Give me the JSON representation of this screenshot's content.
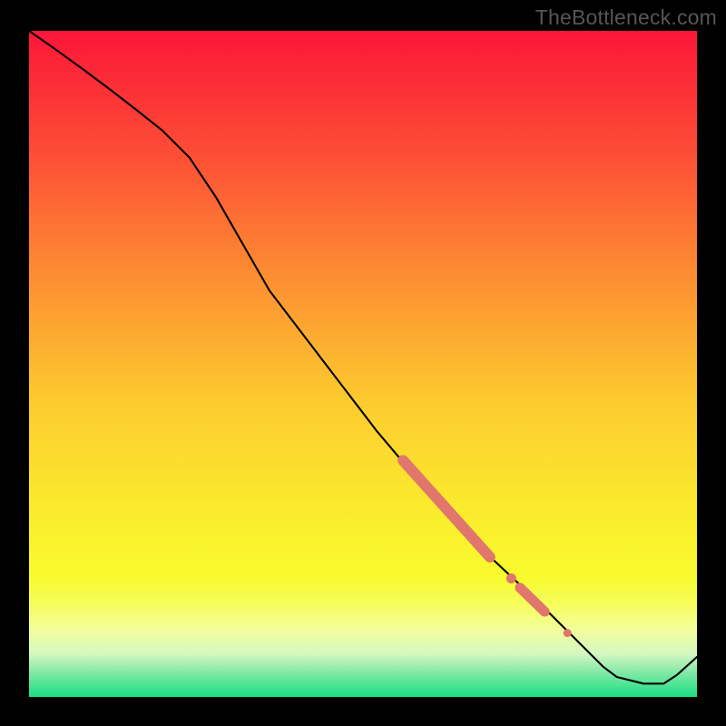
{
  "watermark": "TheBottleneck.com",
  "chart_data": {
    "type": "line",
    "title": "",
    "xlabel": "",
    "ylabel": "",
    "xlim": [
      0,
      100
    ],
    "ylim": [
      0,
      100
    ],
    "grid": false,
    "legend": false,
    "background": {
      "type": "vertical-gradient",
      "stops": [
        {
          "pos": 0.0,
          "color": "#fc1638"
        },
        {
          "pos": 0.18,
          "color": "#fd4c35"
        },
        {
          "pos": 0.36,
          "color": "#fd8b32"
        },
        {
          "pos": 0.55,
          "color": "#fcc92e"
        },
        {
          "pos": 0.7,
          "color": "#fbe82d"
        },
        {
          "pos": 0.82,
          "color": "#f8fb2d"
        },
        {
          "pos": 0.86,
          "color": "#f6fd5b"
        },
        {
          "pos": 0.9,
          "color": "#f2fe9d"
        },
        {
          "pos": 0.935,
          "color": "#d4f8c1"
        },
        {
          "pos": 0.965,
          "color": "#7de8a3"
        },
        {
          "pos": 1.0,
          "color": "#1adf82"
        }
      ]
    },
    "series": [
      {
        "name": "main-curve",
        "color": "#000000",
        "width": 2.1,
        "x": [
          0.0,
          4.0,
          8.0,
          12.0,
          16.0,
          20.0,
          24.0,
          28.0,
          32.0,
          36.0,
          44.0,
          52.0,
          60.0,
          68.0,
          76.0,
          82.0,
          86.0,
          88.0,
          92.0,
          95.0,
          97.0,
          100.0
        ],
        "y": [
          100.0,
          97.2,
          94.3,
          91.3,
          88.2,
          85.0,
          81.0,
          75.0,
          68.0,
          61.0,
          50.5,
          40.0,
          30.5,
          22.0,
          14.5,
          8.5,
          4.5,
          3.0,
          2.0,
          2.0,
          3.3,
          6.0
        ]
      }
    ],
    "markers": [
      {
        "name": "highlight-segment-1",
        "type": "capsule",
        "color": "#e1766c",
        "width": 12,
        "x1": 56.0,
        "y1": 35.5,
        "x2": 69.0,
        "y2": 21.0
      },
      {
        "name": "highlight-dot-1",
        "type": "circle",
        "color": "#e1766c",
        "r": 5.5,
        "x": 72.2,
        "y": 17.8
      },
      {
        "name": "highlight-segment-2",
        "type": "capsule",
        "color": "#e1766c",
        "width": 11,
        "x1": 73.5,
        "y1": 16.4,
        "x2": 77.2,
        "y2": 12.8
      },
      {
        "name": "highlight-dot-2",
        "type": "circle",
        "color": "#e1766c",
        "r": 4.5,
        "x": 80.6,
        "y": 9.6
      }
    ]
  }
}
